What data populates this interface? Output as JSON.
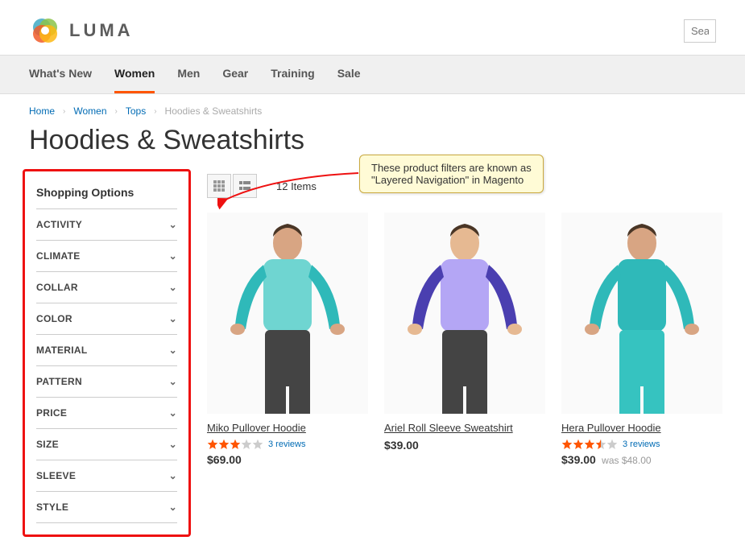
{
  "brand": {
    "name": "LUMA"
  },
  "search": {
    "placeholder": "Sea"
  },
  "nav": {
    "items": [
      "What's New",
      "Women",
      "Men",
      "Gear",
      "Training",
      "Sale"
    ],
    "active_index": 1
  },
  "breadcrumb": {
    "items": [
      "Home",
      "Women",
      "Tops"
    ],
    "current": "Hoodies & Sweatshirts"
  },
  "page_title": "Hoodies & Sweatshirts",
  "sidebar": {
    "heading": "Shopping Options",
    "filters": [
      "ACTIVITY",
      "CLIMATE",
      "COLLAR",
      "COLOR",
      "MATERIAL",
      "PATTERN",
      "PRICE",
      "SIZE",
      "SLEEVE",
      "STYLE"
    ]
  },
  "toolbar": {
    "item_count": "12 Items"
  },
  "products": [
    {
      "name": "Miko Pullover Hoodie",
      "rating": 3,
      "reviews": "3 reviews",
      "price": "$69.00",
      "was": "",
      "colors": {
        "sleeve": "#2fb9b9",
        "body": "#6fd5d1",
        "skin": "#d8a583",
        "pants": "#444"
      }
    },
    {
      "name": "Ariel Roll Sleeve Sweatshirt",
      "rating": 0,
      "reviews": "",
      "price": "$39.00",
      "was": "",
      "colors": {
        "sleeve": "#4a3fb0",
        "body": "#b4a6f5",
        "skin": "#e6b992",
        "pants": "#444"
      }
    },
    {
      "name": "Hera Pullover Hoodie",
      "rating": 3.5,
      "reviews": "3 reviews",
      "price": "$39.00",
      "was": "was $48.00",
      "colors": {
        "sleeve": "#2fb9b9",
        "body": "#2fb9b9",
        "skin": "#d8a583",
        "pants": "#36c3c0"
      }
    }
  ],
  "callout": {
    "text_l1": "These product filters are known as",
    "text_l2": "\"Layered Navigation\" in Magento"
  }
}
